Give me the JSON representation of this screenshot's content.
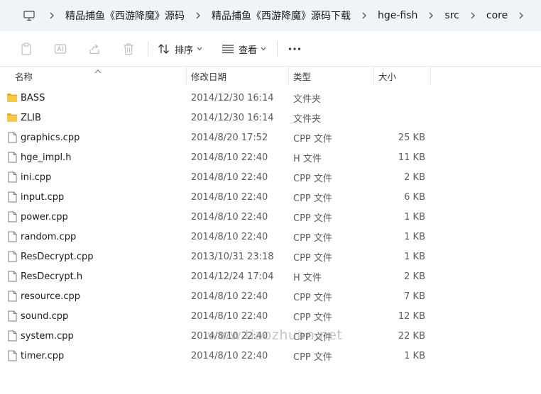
{
  "breadcrumb": {
    "items": [
      "精品捕鱼《西游降魔》源码",
      "精品捕鱼《西游降魔》源码下载",
      "hge-fish",
      "src",
      "core"
    ]
  },
  "toolbar": {
    "sort_label": "排序",
    "view_label": "查看"
  },
  "columns": {
    "name": "名称",
    "date": "修改日期",
    "type": "类型",
    "size": "大小"
  },
  "files": [
    {
      "name": "BASS",
      "date": "2014/12/30 16:14",
      "type": "文件夹",
      "size": "",
      "icon": "folder-icon"
    },
    {
      "name": "ZLIB",
      "date": "2014/12/30 16:14",
      "type": "文件夹",
      "size": "",
      "icon": "folder-icon"
    },
    {
      "name": "graphics.cpp",
      "date": "2014/8/20 17:52",
      "type": "CPP 文件",
      "size": "25 KB",
      "icon": "file-icon"
    },
    {
      "name": "hge_impl.h",
      "date": "2014/8/10 22:40",
      "type": "H 文件",
      "size": "11 KB",
      "icon": "file-icon"
    },
    {
      "name": "ini.cpp",
      "date": "2014/8/10 22:40",
      "type": "CPP 文件",
      "size": "2 KB",
      "icon": "file-icon"
    },
    {
      "name": "input.cpp",
      "date": "2014/8/10 22:40",
      "type": "CPP 文件",
      "size": "6 KB",
      "icon": "file-icon"
    },
    {
      "name": "power.cpp",
      "date": "2014/8/10 22:40",
      "type": "CPP 文件",
      "size": "1 KB",
      "icon": "file-icon"
    },
    {
      "name": "random.cpp",
      "date": "2014/8/10 22:40",
      "type": "CPP 文件",
      "size": "1 KB",
      "icon": "file-icon"
    },
    {
      "name": "ResDecrypt.cpp",
      "date": "2013/10/31 23:18",
      "type": "CPP 文件",
      "size": "1 KB",
      "icon": "file-icon"
    },
    {
      "name": "ResDecrypt.h",
      "date": "2014/12/24 17:04",
      "type": "H 文件",
      "size": "2 KB",
      "icon": "file-icon"
    },
    {
      "name": "resource.cpp",
      "date": "2014/8/10 22:40",
      "type": "CPP 文件",
      "size": "7 KB",
      "icon": "file-icon"
    },
    {
      "name": "sound.cpp",
      "date": "2014/8/10 22:40",
      "type": "CPP 文件",
      "size": "12 KB",
      "icon": "file-icon"
    },
    {
      "name": "system.cpp",
      "date": "2014/8/10 22:40",
      "type": "CPP 文件",
      "size": "22 KB",
      "icon": "file-icon"
    },
    {
      "name": "timer.cpp",
      "date": "2014/8/10 22:40",
      "type": "CPP 文件",
      "size": "1 KB",
      "icon": "file-icon"
    }
  ],
  "watermark": "www.tiaozhuan.net"
}
